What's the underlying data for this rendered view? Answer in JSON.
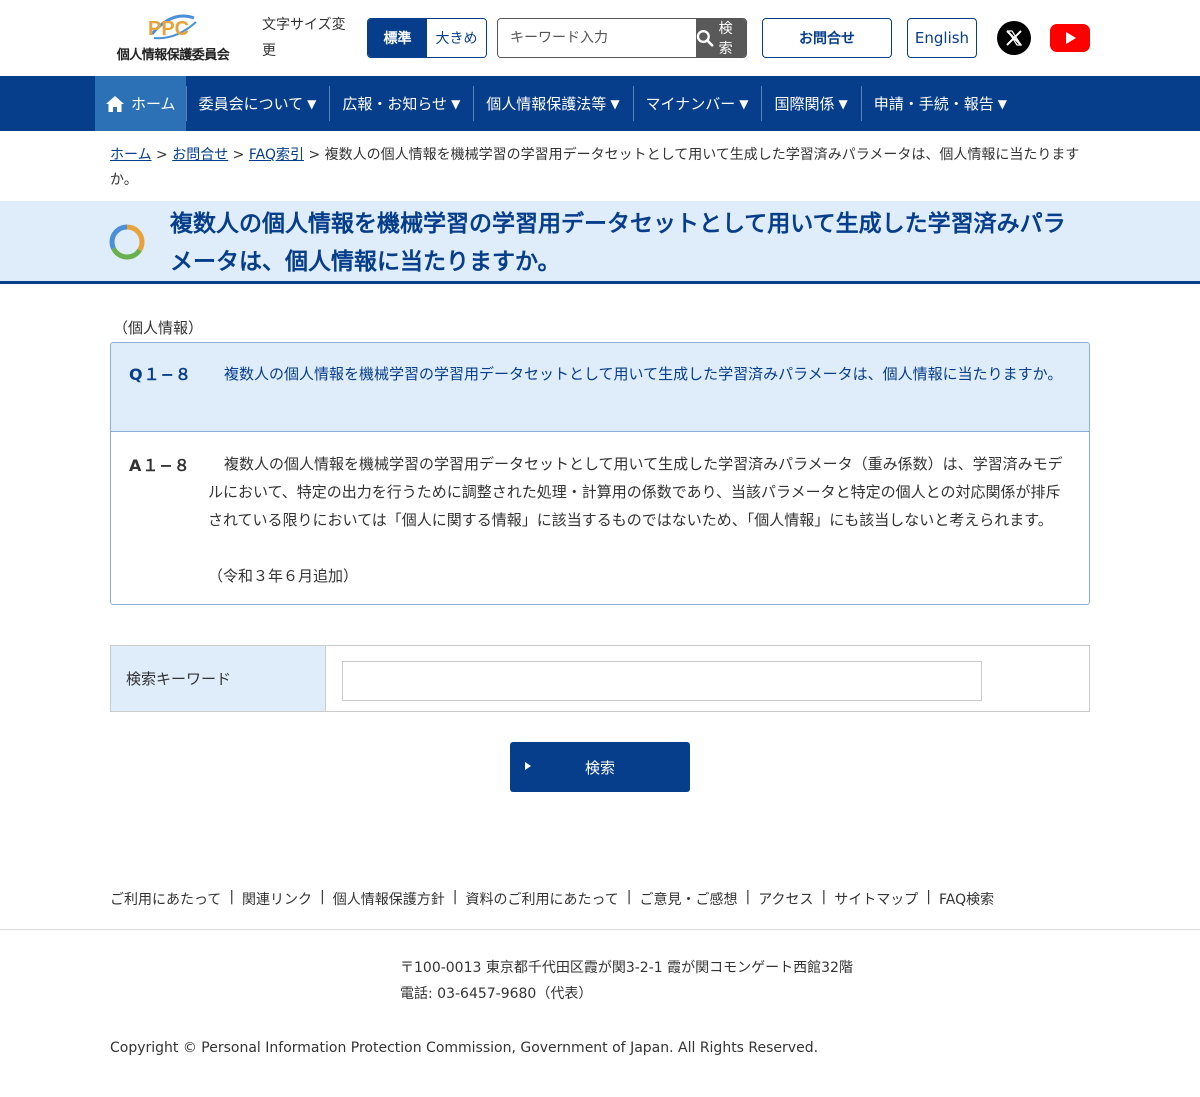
{
  "header": {
    "logo_mark": "PPC",
    "logo_text": "個人情報保護委員会",
    "fontsize_label": "文字サイズ変更",
    "fontsize_standard": "標準",
    "fontsize_large": "大きめ",
    "search_placeholder": "キーワード入力",
    "search_button": "検索",
    "contact": "お問合せ",
    "english": "English"
  },
  "nav": {
    "items": [
      {
        "label": "ホーム"
      },
      {
        "label": "委員会について"
      },
      {
        "label": "広報・お知らせ"
      },
      {
        "label": "個人情報保護法等"
      },
      {
        "label": "マイナンバー"
      },
      {
        "label": "国際関係"
      },
      {
        "label": "申請・手続・報告"
      }
    ]
  },
  "breadcrumb": {
    "home": "ホーム",
    "contact": "お問合せ",
    "faq": "FAQ索引",
    "sep": " > ",
    "current": "複数人の個人情報を機械学習の学習用データセットとして用いて生成した学習済みパラメータは、個人情報に当たりますか。"
  },
  "page": {
    "title": "複数人の個人情報を機械学習の学習用データセットとして用いて生成した学習済みパラメータは、個人情報に当たりますか。",
    "category": "（個人情報）"
  },
  "qa": {
    "q_label": "Q１−８",
    "q_text": "複数人の個人情報を機械学習の学習用データセットとして用いて生成した学習済みパラメータは、個人情報に当たりますか。",
    "a_label": "A１−８",
    "a_text": "複数人の個人情報を機械学習の学習用データセットとして用いて生成した学習済みパラメータ（重み係数）は、学習済みモデルにおいて、特定の出力を行うために調整された処理・計算用の係数であり、当該パラメータと特定の個人との対応関係が排斥されている限りにおいては「個人に関する情報」に該当するものではないため、「個人情報」にも該当しないと考えられます。",
    "a_note": "（令和３年６月追加）"
  },
  "keyword_search": {
    "label": "検索キーワード",
    "value": "",
    "submit": "検索"
  },
  "footer": {
    "links": [
      {
        "label": "ご利用にあたって"
      },
      {
        "label": "関連リンク"
      },
      {
        "label": "個人情報保護方針"
      },
      {
        "label": "資料のご利用にあたって"
      },
      {
        "label": "ご意見・ご感想"
      },
      {
        "label": "アクセス"
      },
      {
        "label": "サイトマップ"
      },
      {
        "label": "FAQ検索"
      }
    ],
    "separator": "|",
    "address": "〒100-0013 東京都千代田区霞が関3-2-1 霞が関コモンゲート西館32階",
    "phone": "電話: 03-6457-9680（代表）",
    "copyright": "Copyright © Personal Information Protection Commission, Government of Japan. All Rights Reserved."
  },
  "colors": {
    "brand_blue": "#063e8c",
    "nav_home_active": "#2c71b6",
    "light_blue_bg": "#dfecfa",
    "youtube_red": "#ff0000"
  },
  "icons": {
    "home": "home-icon",
    "search": "search-icon",
    "x": "x-logo-icon",
    "youtube": "youtube-icon",
    "title": "ring-icon",
    "caret": "caret-down-icon",
    "submit_arrow": "play-arrow-icon"
  }
}
